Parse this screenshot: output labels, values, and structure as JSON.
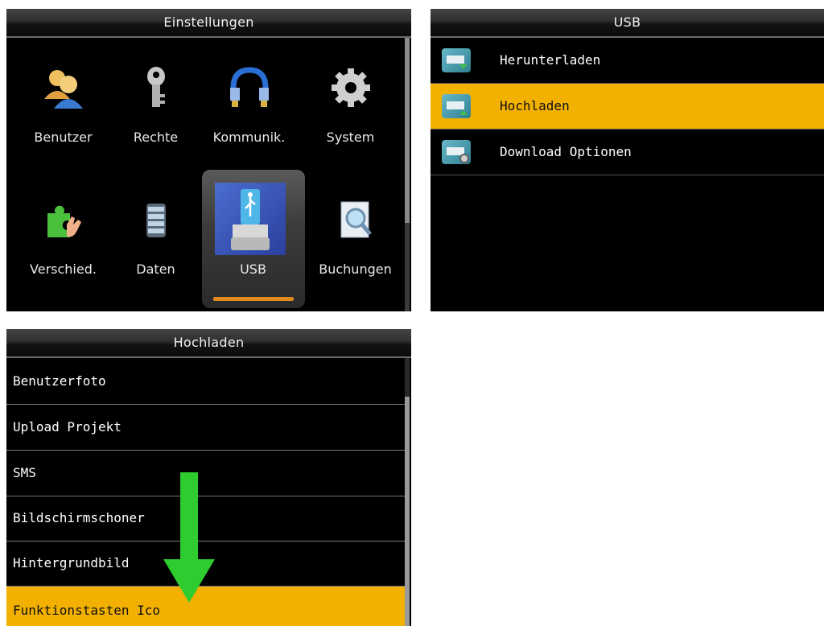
{
  "menu_screen": {
    "title": "Einstellungen",
    "items": [
      {
        "label": "Benutzer",
        "icon": "users-icon"
      },
      {
        "label": "Rechte",
        "icon": "key-icon"
      },
      {
        "label": "Kommunik.",
        "icon": "network-cable-icon"
      },
      {
        "label": "System",
        "icon": "gear-icon"
      },
      {
        "label": "Verschied.",
        "icon": "puzzle-hand-icon"
      },
      {
        "label": "Daten",
        "icon": "database-icon"
      },
      {
        "label": "USB",
        "icon": "usb-drive-icon",
        "selected": true
      },
      {
        "label": "Buchungen",
        "icon": "magnifier-document-icon"
      }
    ]
  },
  "usb_screen": {
    "title": "USB",
    "items": [
      {
        "label": "Herunterladen",
        "icon": "usb-download-icon"
      },
      {
        "label": "Hochladen",
        "icon": "usb-upload-icon",
        "selected": true
      },
      {
        "label": "Download Optionen",
        "icon": "usb-options-icon"
      }
    ]
  },
  "upload_screen": {
    "title": "Hochladen",
    "items": [
      {
        "label": "Benutzerfoto"
      },
      {
        "label": "Upload Projekt"
      },
      {
        "label": "SMS"
      },
      {
        "label": "Bildschirmschoner"
      },
      {
        "label": "Hintergrundbild"
      },
      {
        "label": "Funktionstasten Ico",
        "selected": true
      }
    ]
  },
  "colors": {
    "highlight": "#f2b100",
    "selection_bar": "#e08a1e",
    "annotation_arrow": "#2ecc2e"
  }
}
